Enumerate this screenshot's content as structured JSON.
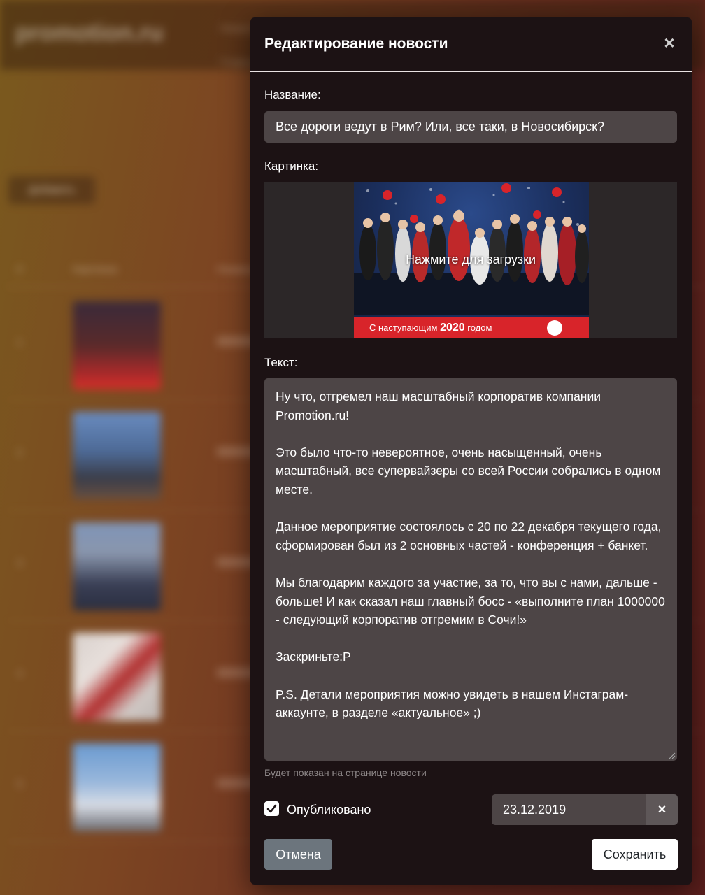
{
  "background": {
    "logo": "promotion.ru",
    "nav_items": [
      "Новости",
      "Главная"
    ],
    "add_button_label": "Добавить",
    "table_headers": [
      "#",
      "Картинка",
      "Название"
    ],
    "row_numbers": [
      "1",
      "2",
      "3",
      "4",
      "5"
    ],
    "colors": {
      "accent_orange": "#7a5a1e",
      "accent_red": "#5a1e1c"
    }
  },
  "modal": {
    "title": "Редактирование новости",
    "close_icon": "close-icon",
    "title_field": {
      "label": "Название:",
      "value": "Все дороги ведут в Рим? Или, все таки, в Новосибирск?"
    },
    "image_field": {
      "label": "Картинка:",
      "upload_text": "Нажмите для загрузки",
      "banner_prefix": "С наступающим",
      "banner_year": "2020",
      "banner_suffix": "годом"
    },
    "text_field": {
      "label": "Текст:",
      "value": "Ну что, отгремел наш масштабный корпоратив компании Promotion.ru!\n\nЭто было что-то невероятное, очень насыщенный, очень масштабный, все супервайзеры со всей России собрались в одном месте.\n\nДанное мероприятие состоялось с 20 по 22 декабря текущего года, сформирован был из 2 основных частей - конференция + банкет.\n\nМы благодарим каждого за участие, за то, что вы с нами, дальше - больше! И как сказал наш главный босс - «выполните план 1000000 - следующий корпоратив отгремим в Сочи!»\n\nЗаскриньте:P\n\nP.S. Детали мероприятия можно увидеть в нашем Инстаграм-аккаунте, в разделе «актуальное» ;)",
      "hint": "Будет показан на странице новости"
    },
    "published": {
      "label": "Опубликовано",
      "checked": true
    },
    "date": {
      "value": "23.12.2019",
      "clear_icon": "clear-icon"
    },
    "buttons": {
      "cancel": "Отмена",
      "save": "Сохранить"
    }
  }
}
